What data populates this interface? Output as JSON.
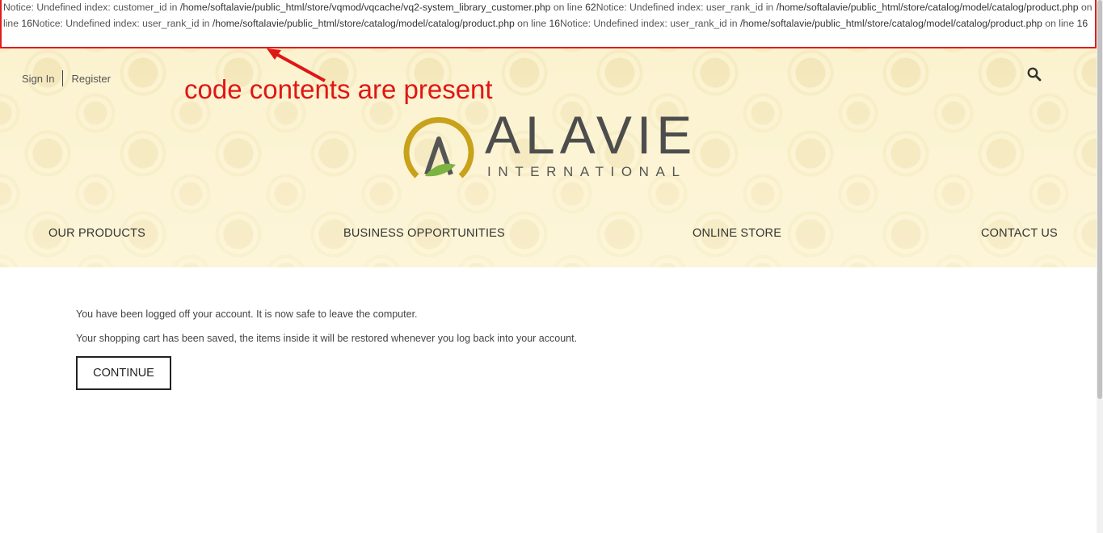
{
  "notice": {
    "segments": [
      {
        "t": "Notice: Undefined index: customer_id in ",
        "p": false
      },
      {
        "t": "/home/softalavie/public_html/store/vqmod/vqcache/vq2-system_library_customer.php",
        "p": true
      },
      {
        "t": " on line ",
        "p": false
      },
      {
        "t": "62",
        "p": true
      },
      {
        "t": "Notice: Undefined index: user_rank_id in ",
        "p": false
      },
      {
        "t": "/home/softalavie/public_html/store/catalog/model/catalog/product.php",
        "p": true
      },
      {
        "t": " on line ",
        "p": false
      },
      {
        "t": "16",
        "p": true
      },
      {
        "t": "Notice: Undefined index: user_rank_id in ",
        "p": false
      },
      {
        "t": "/home/softalavie/public_html/store/catalog/model/catalog/product.php",
        "p": true
      },
      {
        "t": " on line ",
        "p": false
      },
      {
        "t": "16",
        "p": true
      },
      {
        "t": "Notice: Undefined index: user_rank_id in ",
        "p": false
      },
      {
        "t": "/home/softalavie/public_html/store/catalog/model/catalog/product.php",
        "p": true
      },
      {
        "t": " on line ",
        "p": false
      },
      {
        "t": "16",
        "p": true
      }
    ]
  },
  "annotation": "code contents are present",
  "top_links": {
    "sign_in": "Sign In",
    "register": "Register"
  },
  "logo": {
    "word": "ALAVIE",
    "sub": "INTERNATIONAL"
  },
  "nav": {
    "products": "OUR PRODUCTS",
    "business": "BUSINESS OPPORTUNITIES",
    "store": "ONLINE STORE",
    "contact": "CONTACT US"
  },
  "main": {
    "line1": "You have been logged off your account. It is now safe to leave the computer.",
    "line2": "Your shopping cart has been saved, the items inside it will be restored whenever you log back into your account.",
    "continue": "CONTINUE"
  },
  "colors": {
    "notice_border": "#e01c1c",
    "annotation": "#e01616",
    "banner": "#f9efc6",
    "logo_gold": "#c7a21a",
    "logo_green": "#7cb342"
  },
  "icons": {
    "search": "search-icon",
    "arrow": "arrow-icon",
    "logo": "logo-mark-icon"
  }
}
